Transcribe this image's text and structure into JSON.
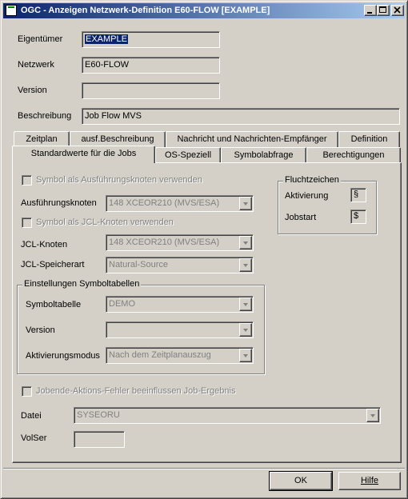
{
  "window": {
    "title": "OGC - Anzeigen Netzwerk-Definition E60-FLOW [EXAMPLE]"
  },
  "header_fields": {
    "owner_label": "Eigentümer",
    "owner_value": "EXAMPLE",
    "network_label": "Netzwerk",
    "network_value": "E60-FLOW",
    "version_label": "Version",
    "version_value": "",
    "description_label": "Beschreibung",
    "description_value": "Job Flow MVS"
  },
  "tabs": {
    "row1": [
      "Zeitplan",
      "ausf.Beschreibung",
      "Nachricht und Nachrichten-Empfänger",
      "Definition"
    ],
    "row2": [
      "Standardwerte für die Jobs",
      "OS-Speziell",
      "Symbolabfrage",
      "Berechtigungen"
    ],
    "active": "Standardwerte für die Jobs"
  },
  "panel": {
    "exec_symbol_checkbox": "Symbol als Ausführungsknoten verwenden",
    "exec_node_label": "Ausführungsknoten",
    "exec_node_value": "148   XCEOR210 (MVS/ESA)",
    "jcl_symbol_checkbox": "Symbol als JCL-Knoten verwenden",
    "jcl_node_label": "JCL-Knoten",
    "jcl_node_value": "148   XCEOR210 (MVS/ESA)",
    "jcl_storage_label": "JCL-Speicherart",
    "jcl_storage_value": "Natural-Source",
    "escape_group": {
      "title": "Fluchtzeichen",
      "activation_label": "Aktivierung",
      "activation_value": "§",
      "jobstart_label": "Jobstart",
      "jobstart_value": "$"
    },
    "symbol_group": {
      "title": "Einstellungen Symboltabellen",
      "table_label": "Symboltabelle",
      "table_value": "DEMO",
      "version_label": "Version",
      "version_value": "",
      "mode_label": "Aktivierungsmodus",
      "mode_value": "Nach dem Zeitplanauszug"
    },
    "jobend_checkbox": "Jobende-Aktions-Fehler beeinflussen Job-Ergebnis",
    "file_label": "Datei",
    "file_value": "SYSEORU",
    "volser_label": "VolSer",
    "volser_value": ""
  },
  "buttons": {
    "ok": "OK",
    "help": "Hilfe"
  }
}
